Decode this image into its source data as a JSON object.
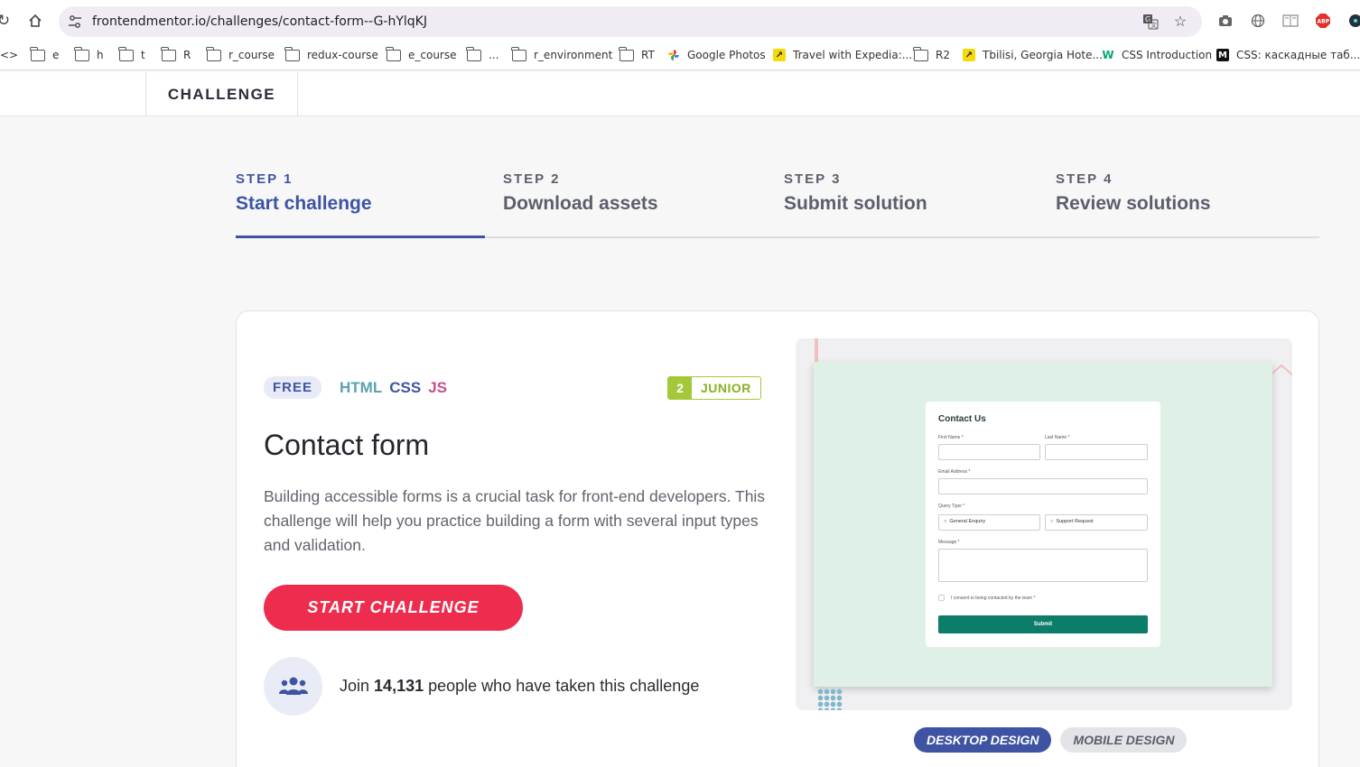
{
  "browser": {
    "url": "frontendmentor.io/challenges/contact-form--G-hYlqKJ",
    "bookmarks": [
      {
        "label": "e",
        "type": "folder"
      },
      {
        "label": "h",
        "type": "folder"
      },
      {
        "label": "t",
        "type": "folder"
      },
      {
        "label": "R",
        "type": "folder"
      },
      {
        "label": "r_course",
        "type": "folder"
      },
      {
        "label": "redux-course",
        "type": "folder"
      },
      {
        "label": "e_course",
        "type": "folder"
      },
      {
        "label": "...",
        "type": "folder"
      },
      {
        "label": "r_environment",
        "type": "folder"
      },
      {
        "label": "RT",
        "type": "folder"
      },
      {
        "label": "Google Photos",
        "type": "site"
      },
      {
        "label": "Travel with Expedia:...",
        "type": "site"
      },
      {
        "label": "R2",
        "type": "folder"
      },
      {
        "label": "Tbilisi, Georgia Hote...",
        "type": "site"
      },
      {
        "label": "CSS Introduction",
        "type": "site"
      },
      {
        "label": "CSS: каскадные таб...",
        "type": "site"
      }
    ]
  },
  "header": {
    "challenge_label": "CHALLENGE"
  },
  "steps": [
    {
      "num": "STEP 1",
      "title": "Start challenge"
    },
    {
      "num": "STEP 2",
      "title": "Download assets"
    },
    {
      "num": "STEP 3",
      "title": "Submit solution"
    },
    {
      "num": "STEP 4",
      "title": "Review solutions"
    }
  ],
  "challenge": {
    "free_label": "FREE",
    "languages": [
      "HTML",
      "CSS",
      "JS"
    ],
    "level_number": "2",
    "level_label": "JUNIOR",
    "title": "Contact form",
    "description": "Building accessible forms is a crucial task for front-end developers. This challenge will help you practice building a form with several input types and validation.",
    "start_label": "START CHALLENGE",
    "join_prefix": "Join",
    "join_count": "14,131",
    "join_suffix": "people who have taken this challenge"
  },
  "preview": {
    "form_title": "Contact Us",
    "first_name": "First Name *",
    "last_name": "Last Name *",
    "email": "Email Address *",
    "query_type": "Query Type *",
    "general": "General Enquiry",
    "support": "Support Request",
    "message": "Message *",
    "consent": "I consent to being contacted by the team *",
    "submit": "Submit"
  },
  "design_tabs": {
    "desktop": "DESKTOP DESIGN",
    "mobile": "MOBILE DESIGN"
  }
}
